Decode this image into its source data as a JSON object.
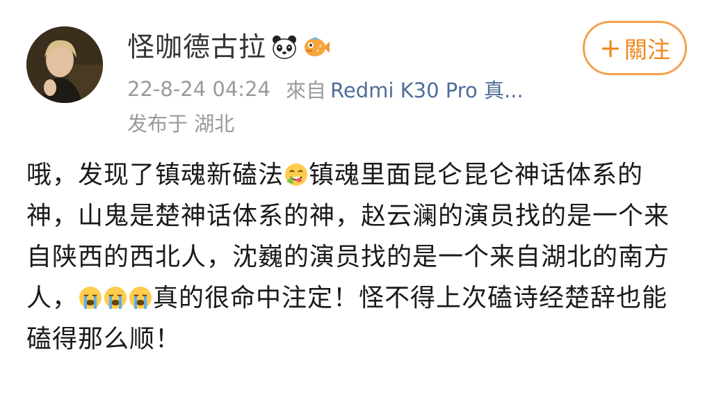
{
  "user": {
    "name": "怪咖德古拉",
    "badges": [
      "panda-icon",
      "fish-icon"
    ]
  },
  "follow_button": {
    "plus": "+",
    "label": "關注"
  },
  "meta": {
    "timestamp": "22-8-24 04:24",
    "from_label": "來自",
    "source": "Redmi K30 Pro 真...",
    "location": "发布于 湖北"
  },
  "post": {
    "segments": [
      "哦，发现了镇魂新磕法",
      "镇魂里面昆仑昆仑神话体系的神，山鬼是楚神话体系的神，赵云澜的演员找的是一个来自陕西的西北人，沈巍的演员找的是一个来自湖北的南方人，",
      "真的很命中注定！怪不得上次磕诗经楚辞也能磕得那么顺！"
    ],
    "emojis": [
      "yummy-face-icon",
      "crying-face-icon"
    ]
  },
  "colors": {
    "accent": "#f0861e",
    "link": "#4e6d99",
    "muted": "#9a9a9a",
    "text": "#1a1a1a"
  }
}
